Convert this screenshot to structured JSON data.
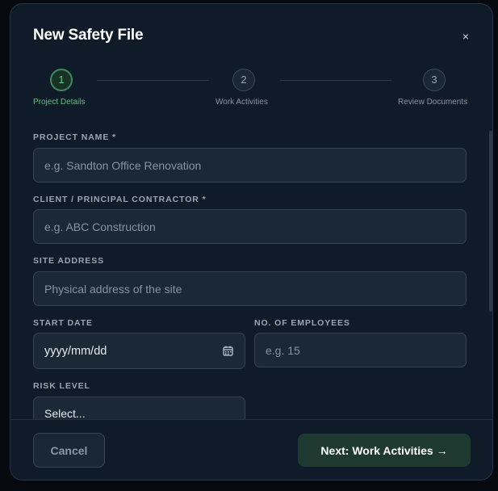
{
  "modal": {
    "title": "New Safety File",
    "close_glyph": "×"
  },
  "stepper": {
    "steps": [
      {
        "number": "1",
        "label": "Project Details",
        "active": true
      },
      {
        "number": "2",
        "label": "Work Activities",
        "active": false
      },
      {
        "number": "3",
        "label": "Review Documents",
        "active": false
      }
    ]
  },
  "form": {
    "project_name": {
      "label": "PROJECT NAME *",
      "placeholder": "e.g. Sandton Office Renovation"
    },
    "client": {
      "label": "CLIENT / PRINCIPAL CONTRACTOR *",
      "placeholder": "e.g. ABC Construction"
    },
    "site_address": {
      "label": "SITE ADDRESS",
      "placeholder": "Physical address of the site"
    },
    "start_date": {
      "label": "START DATE",
      "value": "yyyy/mm/dd"
    },
    "employees": {
      "label": "NO. OF EMPLOYEES",
      "placeholder": "e.g. 15"
    },
    "risk_level": {
      "label": "RISK LEVEL",
      "value": "Select..."
    }
  },
  "footer": {
    "cancel_label": "Cancel",
    "next_label": "Next: Work Activities →"
  },
  "colors": {
    "accent": "#5fcc86",
    "background": "#0f1b28",
    "primary_button": "#1e3a30"
  },
  "icons": {
    "date_picker": "calendar-icon"
  }
}
